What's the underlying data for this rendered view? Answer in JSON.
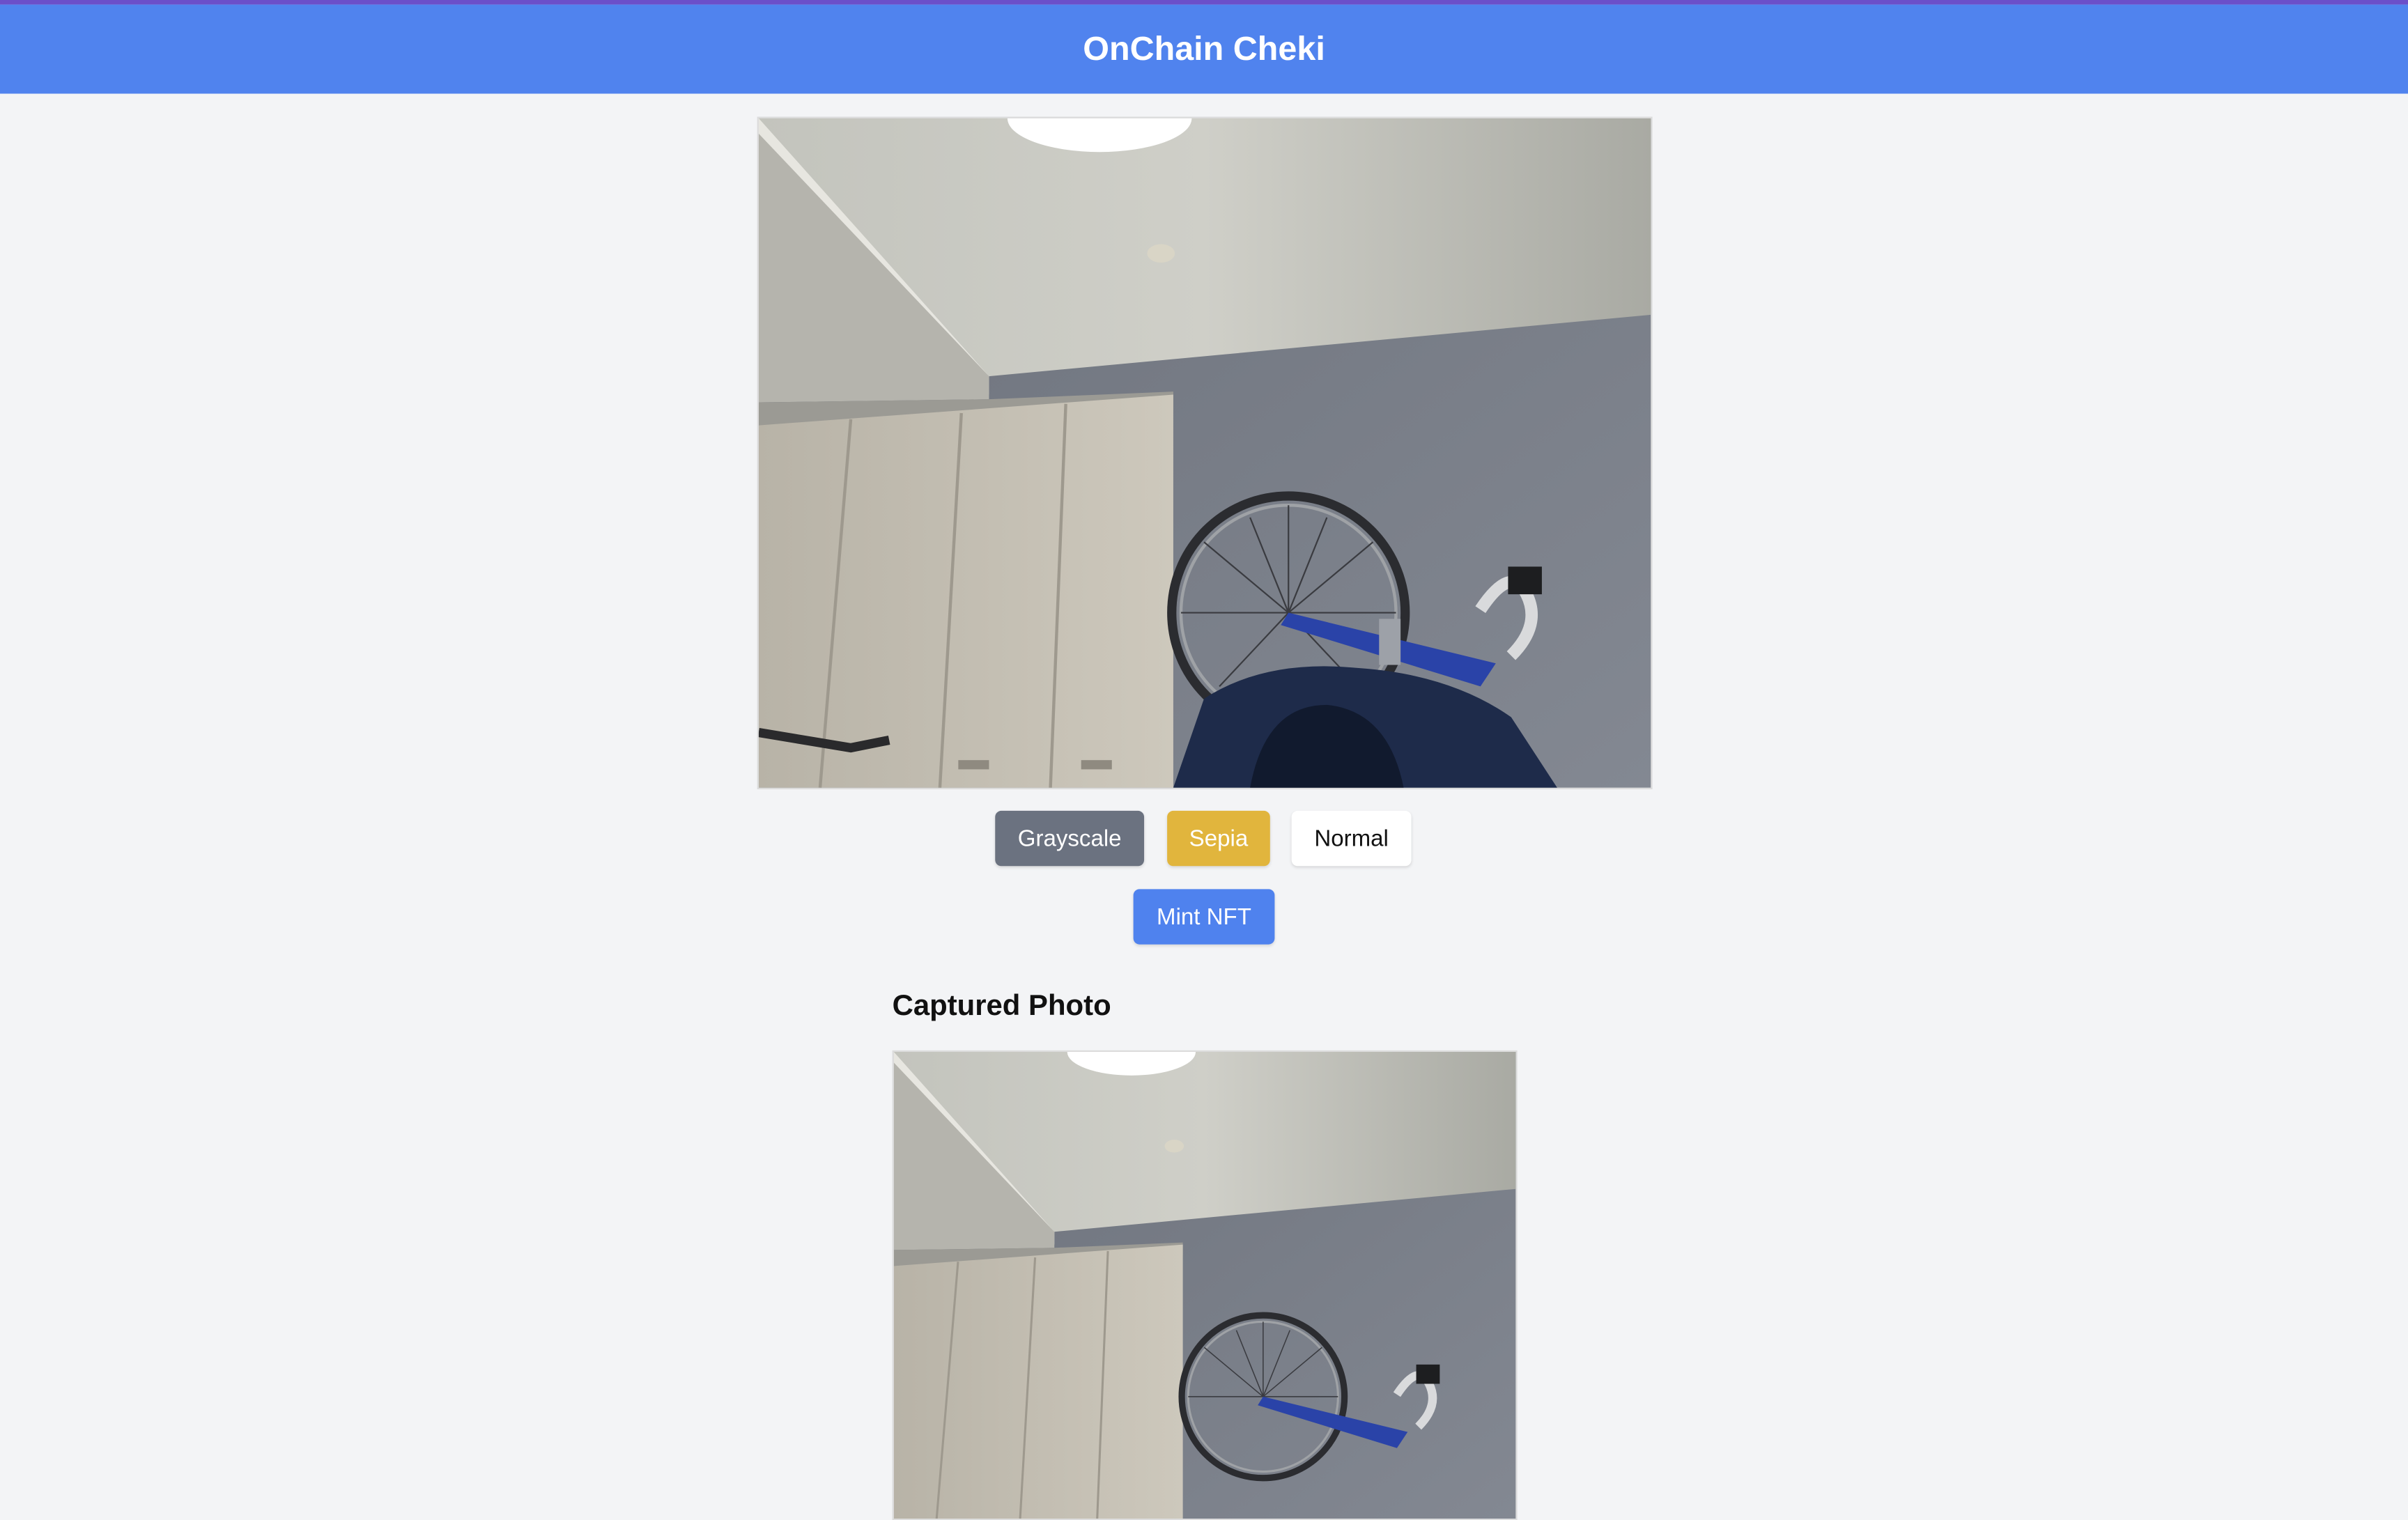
{
  "app": {
    "title": "OnChain Cheki"
  },
  "filters": {
    "grayscale_label": "Grayscale",
    "sepia_label": "Sepia",
    "normal_label": "Normal"
  },
  "actions": {
    "mint_label": "Mint NFT"
  },
  "captured": {
    "heading": "Captured Photo"
  },
  "colors": {
    "header_bg": "#5083ee",
    "grayscale_btn": "#6b7280",
    "sepia_btn": "#e1b53d",
    "normal_btn": "#ffffff",
    "mint_btn": "#4f82ee",
    "page_bg": "#f3f4f6"
  },
  "icons": {
    "camera_feed": "webcam-image",
    "captured_image": "photo-image"
  }
}
